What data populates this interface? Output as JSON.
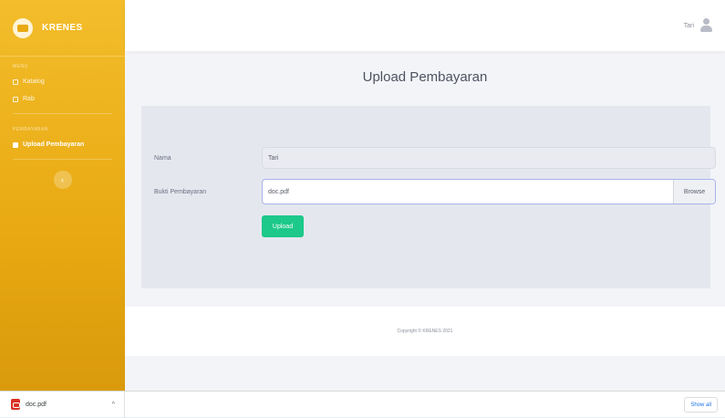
{
  "sidebar": {
    "brand": "KRENES",
    "heading_main": "Menu",
    "items_main": [
      {
        "label": "Katalog"
      },
      {
        "label": "Rab"
      }
    ],
    "heading_payment": "Pembayaran",
    "item_active": "Upload Pembayaran",
    "toggle_icon": "‹"
  },
  "topbar": {
    "user_name": "Tari"
  },
  "page": {
    "title": "Upload Pembayaran"
  },
  "form": {
    "nama_label": "Nama",
    "nama_value": "Tari",
    "bukti_label": "Bukti Pembayaran",
    "file_value": "doc.pdf",
    "browse_label": "Browse",
    "upload_label": "Upload"
  },
  "footer": {
    "copyright": "Copyright © KRENES 2021"
  },
  "download_bar": {
    "file_name": "doc.pdf",
    "chevron": "^",
    "show_all": "Show all"
  },
  "colors": {
    "sidebar_accent": "#e8a912",
    "upload_button": "#1cc88a",
    "pdf_icon": "#d93025"
  }
}
